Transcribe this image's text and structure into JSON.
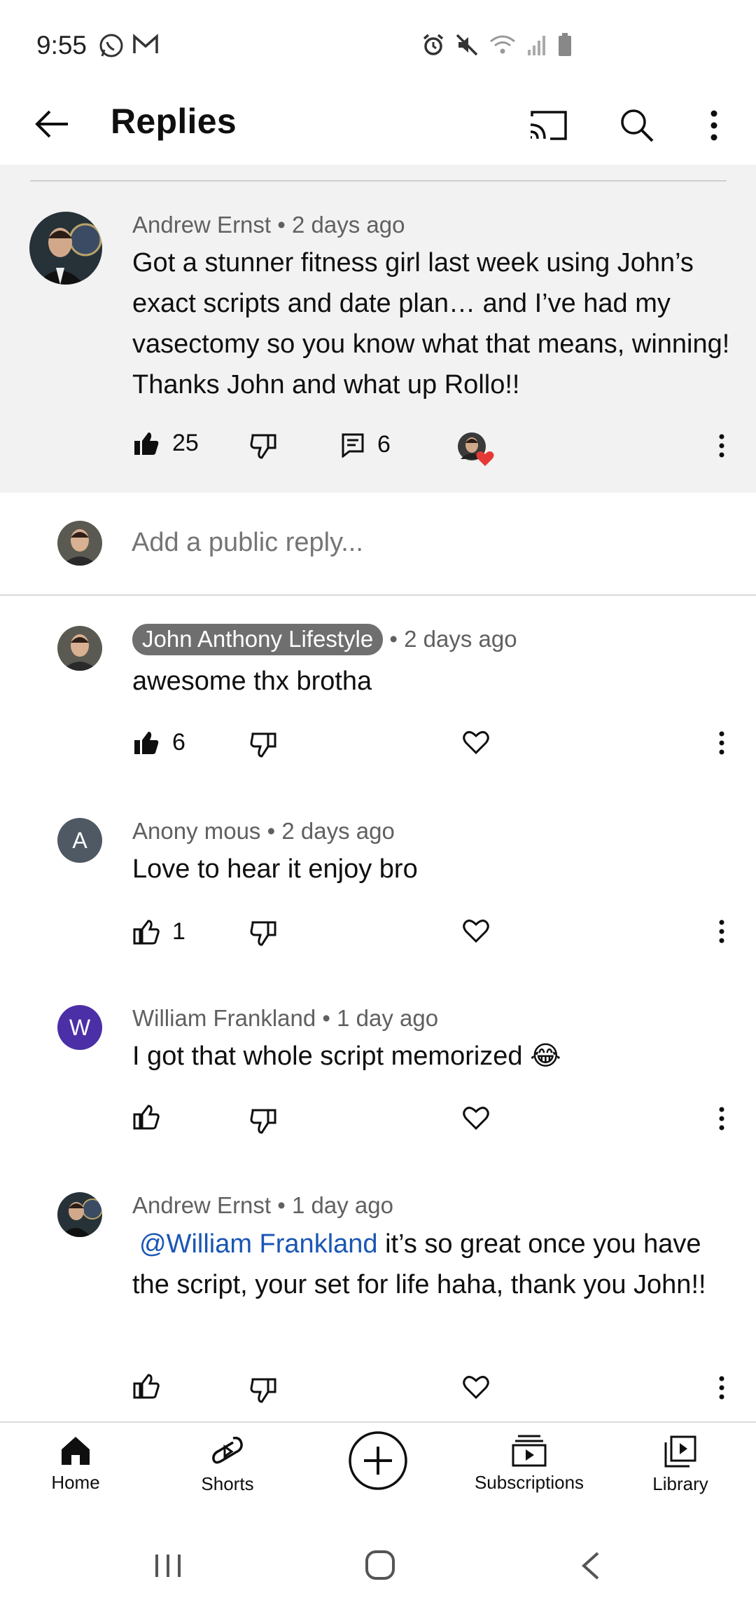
{
  "status_bar": {
    "time": "9:55",
    "left_icons": [
      "whatsapp-icon",
      "gmail-icon"
    ],
    "right_icons": [
      "alarm-icon",
      "mute-icon",
      "wifi-icon",
      "signal-icon",
      "battery-icon"
    ]
  },
  "app_bar": {
    "title": "Replies",
    "icons": [
      "back-arrow-icon",
      "cast-icon",
      "search-icon",
      "more-vert-icon"
    ]
  },
  "parent_comment": {
    "author": "Andrew Ernst",
    "time": "2 days ago",
    "text": "Got a stunner fitness girl last week using John’s exact scripts and date plan… and I’ve had my vasectomy so you know what that means, winning! Thanks John and what up Rollo!!",
    "likes": "25",
    "replies": "6"
  },
  "add_reply": {
    "placeholder": "Add a public reply..."
  },
  "replies": [
    {
      "author": "John Anthony Lifestyle",
      "time": "2 days ago",
      "text": "awesome thx brotha",
      "likes": "6"
    },
    {
      "author": "Anony mous",
      "avatar_letter": "A",
      "time": "2 days ago",
      "text": "Love to hear it enjoy bro",
      "likes": "1"
    },
    {
      "author": "William Frankland",
      "avatar_letter": "W",
      "time": "1 day ago",
      "text": "I got that whole script memorized 😂",
      "likes": ""
    },
    {
      "author": "Andrew Ernst",
      "time": "1 day ago",
      "mention": "@William Frankland",
      "text": " it’s so great once you have the script, your set for life haha, thank you John!!",
      "likes": ""
    }
  ],
  "separator": "•",
  "bottom_nav": {
    "home": "Home",
    "shorts": "Shorts",
    "subscriptions": "Subscriptions",
    "library": "Library"
  },
  "colors": {
    "avatar_a": "#4f5963",
    "avatar_w": "#4b2fa6",
    "heart_badge": "#e53935",
    "mention": "#1a56b4"
  }
}
